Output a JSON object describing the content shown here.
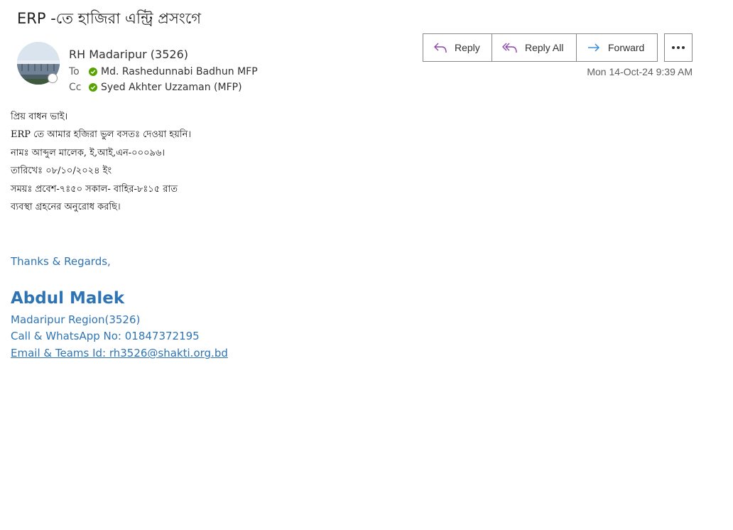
{
  "subject": "ERP -তে হাজিরা এন্ট্রি প্রসংগে",
  "sender": {
    "name": "RH Madaripur (3526)"
  },
  "to": {
    "label": "To",
    "name": "Md. Rashedunnabi Badhun MFP"
  },
  "cc": {
    "label": "Cc",
    "name": "Syed Akhter Uzzaman (MFP)"
  },
  "actions": {
    "reply": "Reply",
    "reply_all": "Reply All",
    "forward": "Forward",
    "more_icon": "ellipsis-icon"
  },
  "date": "Mon 14-Oct-24 9:39 AM",
  "body": {
    "lines": [
      "প্রিয় বাধন ভাই।",
      "ERP তে আমার হজিরা ভুল বসতঃ দেওয়া হয়নি।",
      "নামঃ আব্দুল মালেক,  ই,আই,এন-০০০৯৬।",
      "তারিখেঃ ০৮/১০/২০২৪ ইং",
      "সময়ঃ প্রবেশ-৭ঃ৫০ সকাল- বাহির-৮ঃ১৫ রাত",
      "ব্যবস্থা গ্রহনের অনুরোধ করছি।"
    ]
  },
  "signature": {
    "thanks": "Thanks & Regards,",
    "name": "Abdul Malek",
    "region": "Madaripur Region(3526)",
    "phone": "Call & WhatsApp No: 01847372195",
    "email": "Email & Teams Id: rh3526@shakti.org.bd"
  },
  "colors": {
    "accent": "#2e74b5",
    "presence_available": "#57a300",
    "action_icon": "#8e44ad"
  }
}
